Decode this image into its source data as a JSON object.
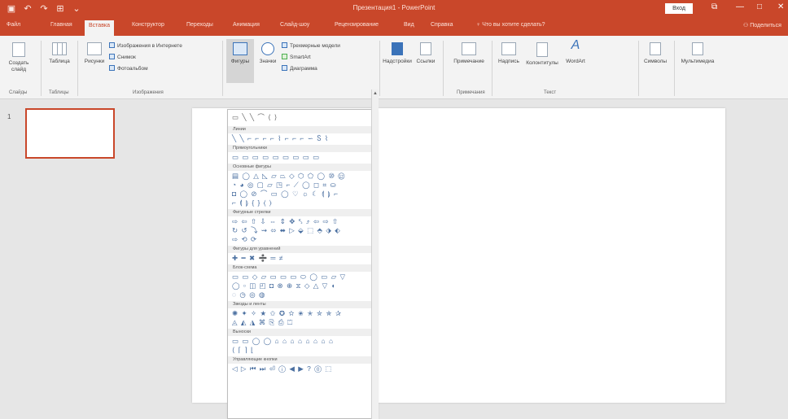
{
  "titlebar": {
    "title": "Презентация1 - PowerPoint",
    "signin": "Вход",
    "qat": [
      "▣",
      "↶",
      "↷",
      "⊞",
      "⌄"
    ],
    "controls": [
      "⧉",
      "—",
      "□",
      "✕"
    ]
  },
  "tabs": [
    "Файл",
    "Главная",
    "Вставка",
    "Конструктор",
    "Переходы",
    "Анимация",
    "Слайд-шоу",
    "Рецензирование",
    "Вид",
    "Справка"
  ],
  "active_tab": "Вставка",
  "tell_me": "♀  Что вы хотите сделать?",
  "share": "⚇ Поделиться",
  "ribbon": {
    "slide_btn": "Создать слайд",
    "table_btn": "Таблица",
    "images_btn": "Рисунки",
    "online_images": "Изображения в Интернете",
    "screenshot": "Снимок",
    "album": "Фотоальбом",
    "shapes_btn": "Фигуры",
    "icons_btn": "Значки",
    "models3d": "Трехмерные модели",
    "smartart": "SmartArt",
    "chart": "Диаграмма",
    "addins": "Надстройки",
    "links": "Ссылки",
    "comment": "Примечание",
    "textbox": "Надпись",
    "headerfooter": "Колонтитулы",
    "wordart": "WordArt",
    "symbols": "Символы",
    "media": "Мультимедиа",
    "groups": {
      "slides": "Слайды",
      "tables": "Таблицы",
      "images": "Изображения",
      "comments": "Примечания",
      "text": "Текст"
    }
  },
  "thumbnails": {
    "slide_number": "1"
  },
  "shapes_menu": {
    "recent_row": "▭ ╲ ╲ ⌒ ⟨ ⟩",
    "sections": [
      {
        "title": "Линии",
        "rows": [
          "╲ ╲ ⌐ ⌐ ⌐ ⌐ ⌇ ⌐ ⌐ ⌐ ∽ Ⴝ ⌇"
        ]
      },
      {
        "title": "Прямоугольники",
        "rows": [
          "▭ ▭ ▭ ▭ ▭ ▭ ▭ ▭ ▭"
        ]
      },
      {
        "title": "Основные фигуры",
        "rows": [
          "▤ ◯ △ ◺ ▱ ⏢ ◇ ⬡ ⬠ ◯ ⑩ ⑫",
          "◔ ◕ ◎ ▢ ▱ ◳ ⌐ ⟋ ◯ ◻ ⌗ ⛀",
          "◘ ◯ ⊘ ⌒ ▭ ◯ ♡ ☼ ☾ ⟬ ⟭ ⌐",
          "⌐ ⟬ ⟭ { } ⟨ ⟩"
        ]
      },
      {
        "title": "Фигурные стрелки",
        "rows": [
          "⇨ ⇦ ⇧ ⇩ ⇔ ⇕ ✥ ⤣ ⤴ ⇦ ⇨ ⇧",
          "↻ ↺ ⤵ ⇝ ⬄ ⬌ ▷ ⬙ ⬚ ⬘ ⬗ ⬖",
          "⇨ ⟲ ⟳"
        ]
      },
      {
        "title": "Фигуры для уравнений",
        "rows": [
          "✚ ━ ✖ ➗ ═ ≠"
        ]
      },
      {
        "title": "Блок-схема",
        "rows": [
          "▭ ▭ ◇ ▱ ▭ ▭ ▭ ⬭ ◯ ▭ ▱ ▽",
          "◯ ▫ ◫ ◰ ◘ ⊗ ⊕ ⧖ ◇ △ ▽ ◖",
          "◌ ◷ ◎ ◍"
        ]
      },
      {
        "title": "Звезды и ленты",
        "rows": [
          "✺ ✦ ✧ ★ ✩ ✪ ✫ ✬ ✭ ✮ ✯ ✰",
          "◬ ◭ ◮ ⌘ ⎘ ⎙ ⏍"
        ]
      },
      {
        "title": "Выноски",
        "rows": [
          "▭ ▭ ◯ ◯ ⌂ ⌂ ⌂ ⌂ ⌂ ⌂ ⌂ ⌂",
          "⟨ ⌈ ⌉ ⌊"
        ]
      },
      {
        "title": "Управляющие кнопки",
        "rows": [
          "◁ ▷ ⏮ ⏭ ⏎ ⓘ ◀ ▶ ? ⓪ ⬚"
        ]
      }
    ]
  }
}
